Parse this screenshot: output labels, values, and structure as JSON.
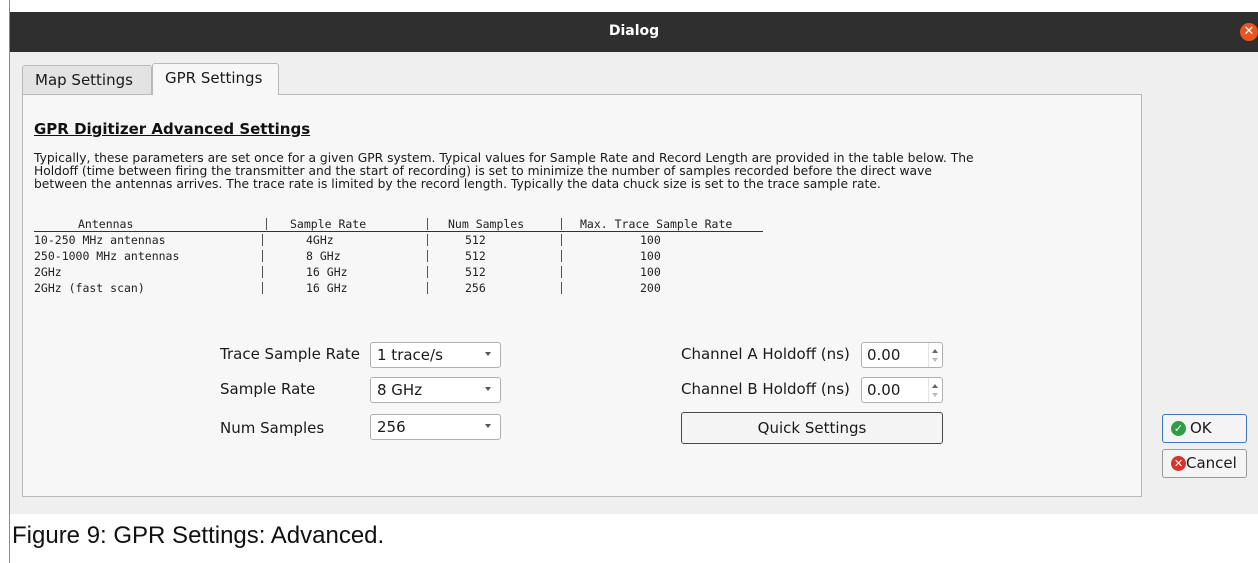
{
  "dialog": {
    "title": "Dialog",
    "close_icon": "close-icon"
  },
  "tabs": [
    {
      "label": "Map Settings",
      "active": false
    },
    {
      "label": "GPR Settings",
      "active": true
    }
  ],
  "panel": {
    "heading": "GPR Digitizer Advanced Settings",
    "description_lines": [
      "Typically, these parameters are set once for a given GPR system. Typical values for Sample Rate and Record Length are provided in the table below. The",
      "Holdoff (time between firing the transmitter and the start of recording) is set to minimize the number of samples recorded before the direct wave",
      "between the antennas arrives.  The trace rate is limited by the record length.  Typically the data chuck size is set to the trace sample rate."
    ],
    "table": {
      "headers": [
        "Antennas",
        "Sample Rate",
        "Num Samples",
        "Max. Trace Sample Rate"
      ],
      "rows": [
        [
          "10-250 MHz antennas",
          "4GHz",
          "512",
          "100"
        ],
        [
          "250-1000 MHz antennas",
          "8 GHz",
          "512",
          "100"
        ],
        [
          "2GHz",
          "16 GHz",
          "512",
          "100"
        ],
        [
          "2GHz (fast scan)",
          "16 GHz",
          "256",
          "200"
        ]
      ]
    },
    "form": {
      "trace_sample_rate": {
        "label": "Trace Sample Rate",
        "value": "1 trace/s"
      },
      "sample_rate": {
        "label": "Sample Rate",
        "value": "8 GHz"
      },
      "num_samples": {
        "label": "Num Samples",
        "value": "256"
      },
      "channel_a_holdoff": {
        "label": "Channel A Holdoff (ns)",
        "value": "0.00"
      },
      "channel_b_holdoff": {
        "label": "Channel B Holdoff (ns)",
        "value": "0.00"
      },
      "quick_settings": "Quick Settings"
    }
  },
  "buttons": {
    "ok": {
      "label": "OK",
      "icon": "check-circle-icon",
      "color": "#2e9d47"
    },
    "cancel": {
      "label": "Cancel",
      "icon": "x-circle-icon",
      "color": "#d8322b"
    }
  },
  "caption": "Figure 9: GPR Settings: Advanced.",
  "colors": {
    "titlebar": "#2f2f2f",
    "close": "#e95420",
    "focus": "#3b77bf"
  }
}
